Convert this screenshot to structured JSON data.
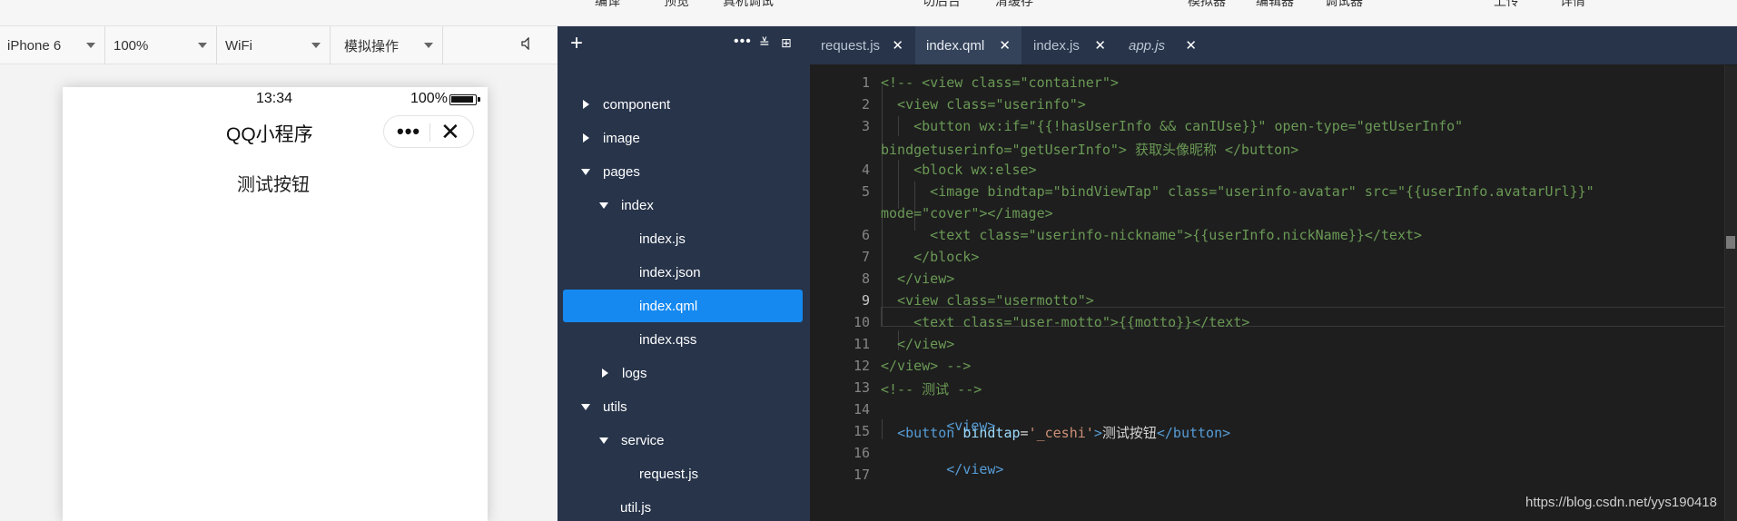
{
  "toolbar": {
    "items": [
      "编译",
      "预览",
      "真机调试",
      "切后台",
      "清缓存",
      "模拟器",
      "编辑器",
      "调试器",
      "上传",
      "详情"
    ]
  },
  "simulator": {
    "device": "iPhone 6",
    "zoom": "100%",
    "network": "WiFi",
    "operation": "模拟操作",
    "status_time": "13:34",
    "battery_text": "100%",
    "page_title": "QQ小程序",
    "capsule_more": "•••",
    "capsule_close": "✕",
    "test_button": "测试按钮"
  },
  "tree": {
    "add_icon": "+",
    "more_icon": "•••",
    "collapse_icon": "≚",
    "newfile_icon": "⊞",
    "nodes": [
      {
        "label": "component",
        "type": "folder",
        "open": false
      },
      {
        "label": "image",
        "type": "folder",
        "open": false
      },
      {
        "label": "pages",
        "type": "folder",
        "open": true
      },
      {
        "label": "index",
        "type": "folder",
        "open": true
      },
      {
        "label": "index.js",
        "type": "file"
      },
      {
        "label": "index.json",
        "type": "file"
      },
      {
        "label": "index.qml",
        "type": "file",
        "active": true
      },
      {
        "label": "index.qss",
        "type": "file"
      },
      {
        "label": "logs",
        "type": "folder",
        "open": false
      },
      {
        "label": "utils",
        "type": "folder",
        "open": true
      },
      {
        "label": "service",
        "type": "folder",
        "open": true
      },
      {
        "label": "request.js",
        "type": "file"
      },
      {
        "label": "util.js",
        "type": "file"
      }
    ]
  },
  "editor": {
    "tabs": [
      {
        "label": "request.js",
        "close": "✕"
      },
      {
        "label": "index.qml",
        "close": "✕",
        "active": true
      },
      {
        "label": "index.js",
        "close": "✕"
      },
      {
        "label": "app.js",
        "close": "✕",
        "italic": true
      }
    ],
    "line_numbers": [
      "1",
      "2",
      "3",
      "4",
      "5",
      "6",
      "7",
      "8",
      "9",
      "10",
      "11",
      "12",
      "13",
      "14",
      "15",
      "16",
      "17"
    ],
    "current_line": "9",
    "lines": {
      "l1": "<!-- <view class=\"container\">",
      "l2": "  <view class=\"userinfo\">",
      "l3a": "    <button wx:if=\"{{!hasUserInfo && canIUse}}\" open-type=\"getUserInfo\"",
      "l3b": "bindgetuserinfo=\"getUserInfo\"> 获取头像昵称 </button>",
      "l4": "    <block wx:else>",
      "l5a": "      <image bindtap=\"bindViewTap\" class=\"userinfo-avatar\" src=\"{{userInfo.avatarUrl}}\"",
      "l5b": "mode=\"cover\"></image>",
      "l6": "      <text class=\"userinfo-nickname\">{{userInfo.nickName}}</text>",
      "l7": "    </block>",
      "l8": "  </view>",
      "l9": "  <view class=\"usermotto\">",
      "l10": "    <text class=\"user-motto\">{{motto}}</text>",
      "l11": "  </view>",
      "l12": "</view> -->",
      "l13": "<!-- 测试 -->",
      "l14_tag": "<view>",
      "l15_open": "<button",
      "l15_attr": "bindtap",
      "l15_eq": "=",
      "l15_str": "'_ceshi'",
      "l15_gt": ">",
      "l15_txt": "测试按钮",
      "l15_close": "</button>",
      "l16_tag": "</view>"
    }
  },
  "watermark": "https://blog.csdn.net/yys190418"
}
